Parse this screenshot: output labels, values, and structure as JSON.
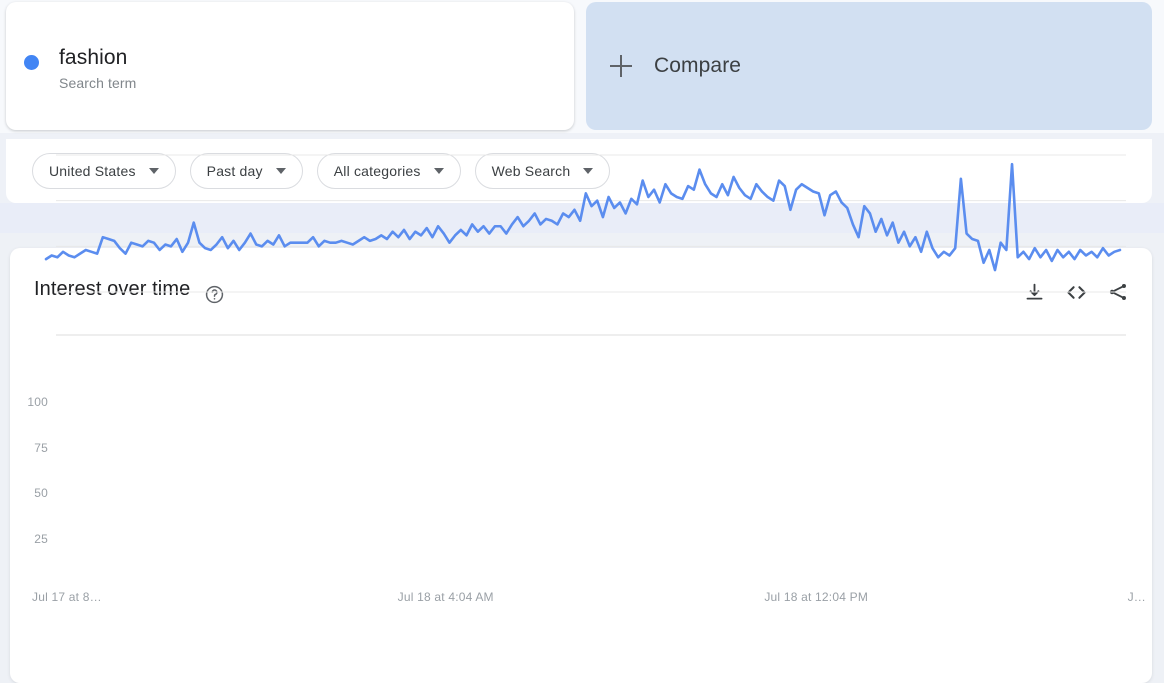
{
  "term_card": {
    "title": "fashion",
    "subtitle": "Search term",
    "dot_color": "#4285f4"
  },
  "compare_card": {
    "label": "Compare",
    "plus_icon": "plus-icon",
    "background": "#d2e0f2"
  },
  "filters": [
    {
      "label": "United States"
    },
    {
      "label": "Past day"
    },
    {
      "label": "All categories"
    },
    {
      "label": "Web Search"
    }
  ],
  "chart_panel": {
    "title": "Interest over time",
    "help_icon": "help-circle-icon",
    "actions": [
      {
        "name": "download-icon"
      },
      {
        "name": "embed-icon"
      },
      {
        "name": "share-icon"
      }
    ]
  },
  "chart_data": {
    "type": "line",
    "title": "Interest over time",
    "xlabel": "",
    "ylabel": "",
    "ylim": [
      0,
      108
    ],
    "yticks": [
      25,
      50,
      75,
      100
    ],
    "grid": true,
    "legend": false,
    "line_color": "#5b8def",
    "xtick_labels": [
      "Jul 17 at 8…",
      "Jul 18 at 4:04 AM",
      "Jul 18 at 12:04 PM",
      "J…"
    ],
    "xtick_positions": [
      0.0,
      0.333,
      0.667,
      1.0
    ],
    "series": [
      {
        "name": "fashion",
        "values": [
          43,
          45,
          44,
          47,
          45,
          44,
          46,
          48,
          47,
          46,
          55,
          54,
          53,
          49,
          46,
          52,
          51,
          50,
          53,
          52,
          48,
          51,
          50,
          54,
          47,
          52,
          63,
          52,
          49,
          48,
          51,
          55,
          49,
          53,
          48,
          52,
          57,
          51,
          50,
          53,
          51,
          56,
          50,
          52,
          52,
          52,
          52,
          55,
          50,
          53,
          52,
          52,
          53,
          52,
          51,
          53,
          55,
          53,
          54,
          56,
          54,
          58,
          55,
          59,
          54,
          58,
          56,
          60,
          55,
          61,
          57,
          52,
          56,
          59,
          56,
          62,
          58,
          61,
          57,
          61,
          61,
          57,
          62,
          66,
          61,
          64,
          68,
          62,
          65,
          64,
          62,
          68,
          66,
          70,
          64,
          79,
          72,
          75,
          66,
          77,
          71,
          74,
          68,
          76,
          73,
          86,
          77,
          81,
          74,
          84,
          79,
          77,
          76,
          83,
          81,
          92,
          84,
          79,
          77,
          84,
          78,
          88,
          82,
          78,
          76,
          84,
          80,
          77,
          75,
          86,
          83,
          70,
          81,
          84,
          82,
          80,
          79,
          67,
          78,
          80,
          74,
          71,
          62,
          55,
          72,
          68,
          58,
          65,
          56,
          63,
          52,
          58,
          50,
          55,
          47,
          58,
          49,
          44,
          47,
          45,
          49,
          87,
          57,
          54,
          53,
          41,
          48,
          37,
          52,
          48,
          95,
          44,
          47,
          43,
          49,
          44,
          48,
          42,
          48,
          44,
          47,
          43,
          48,
          45,
          47,
          44,
          49,
          45,
          47,
          48
        ]
      }
    ]
  }
}
